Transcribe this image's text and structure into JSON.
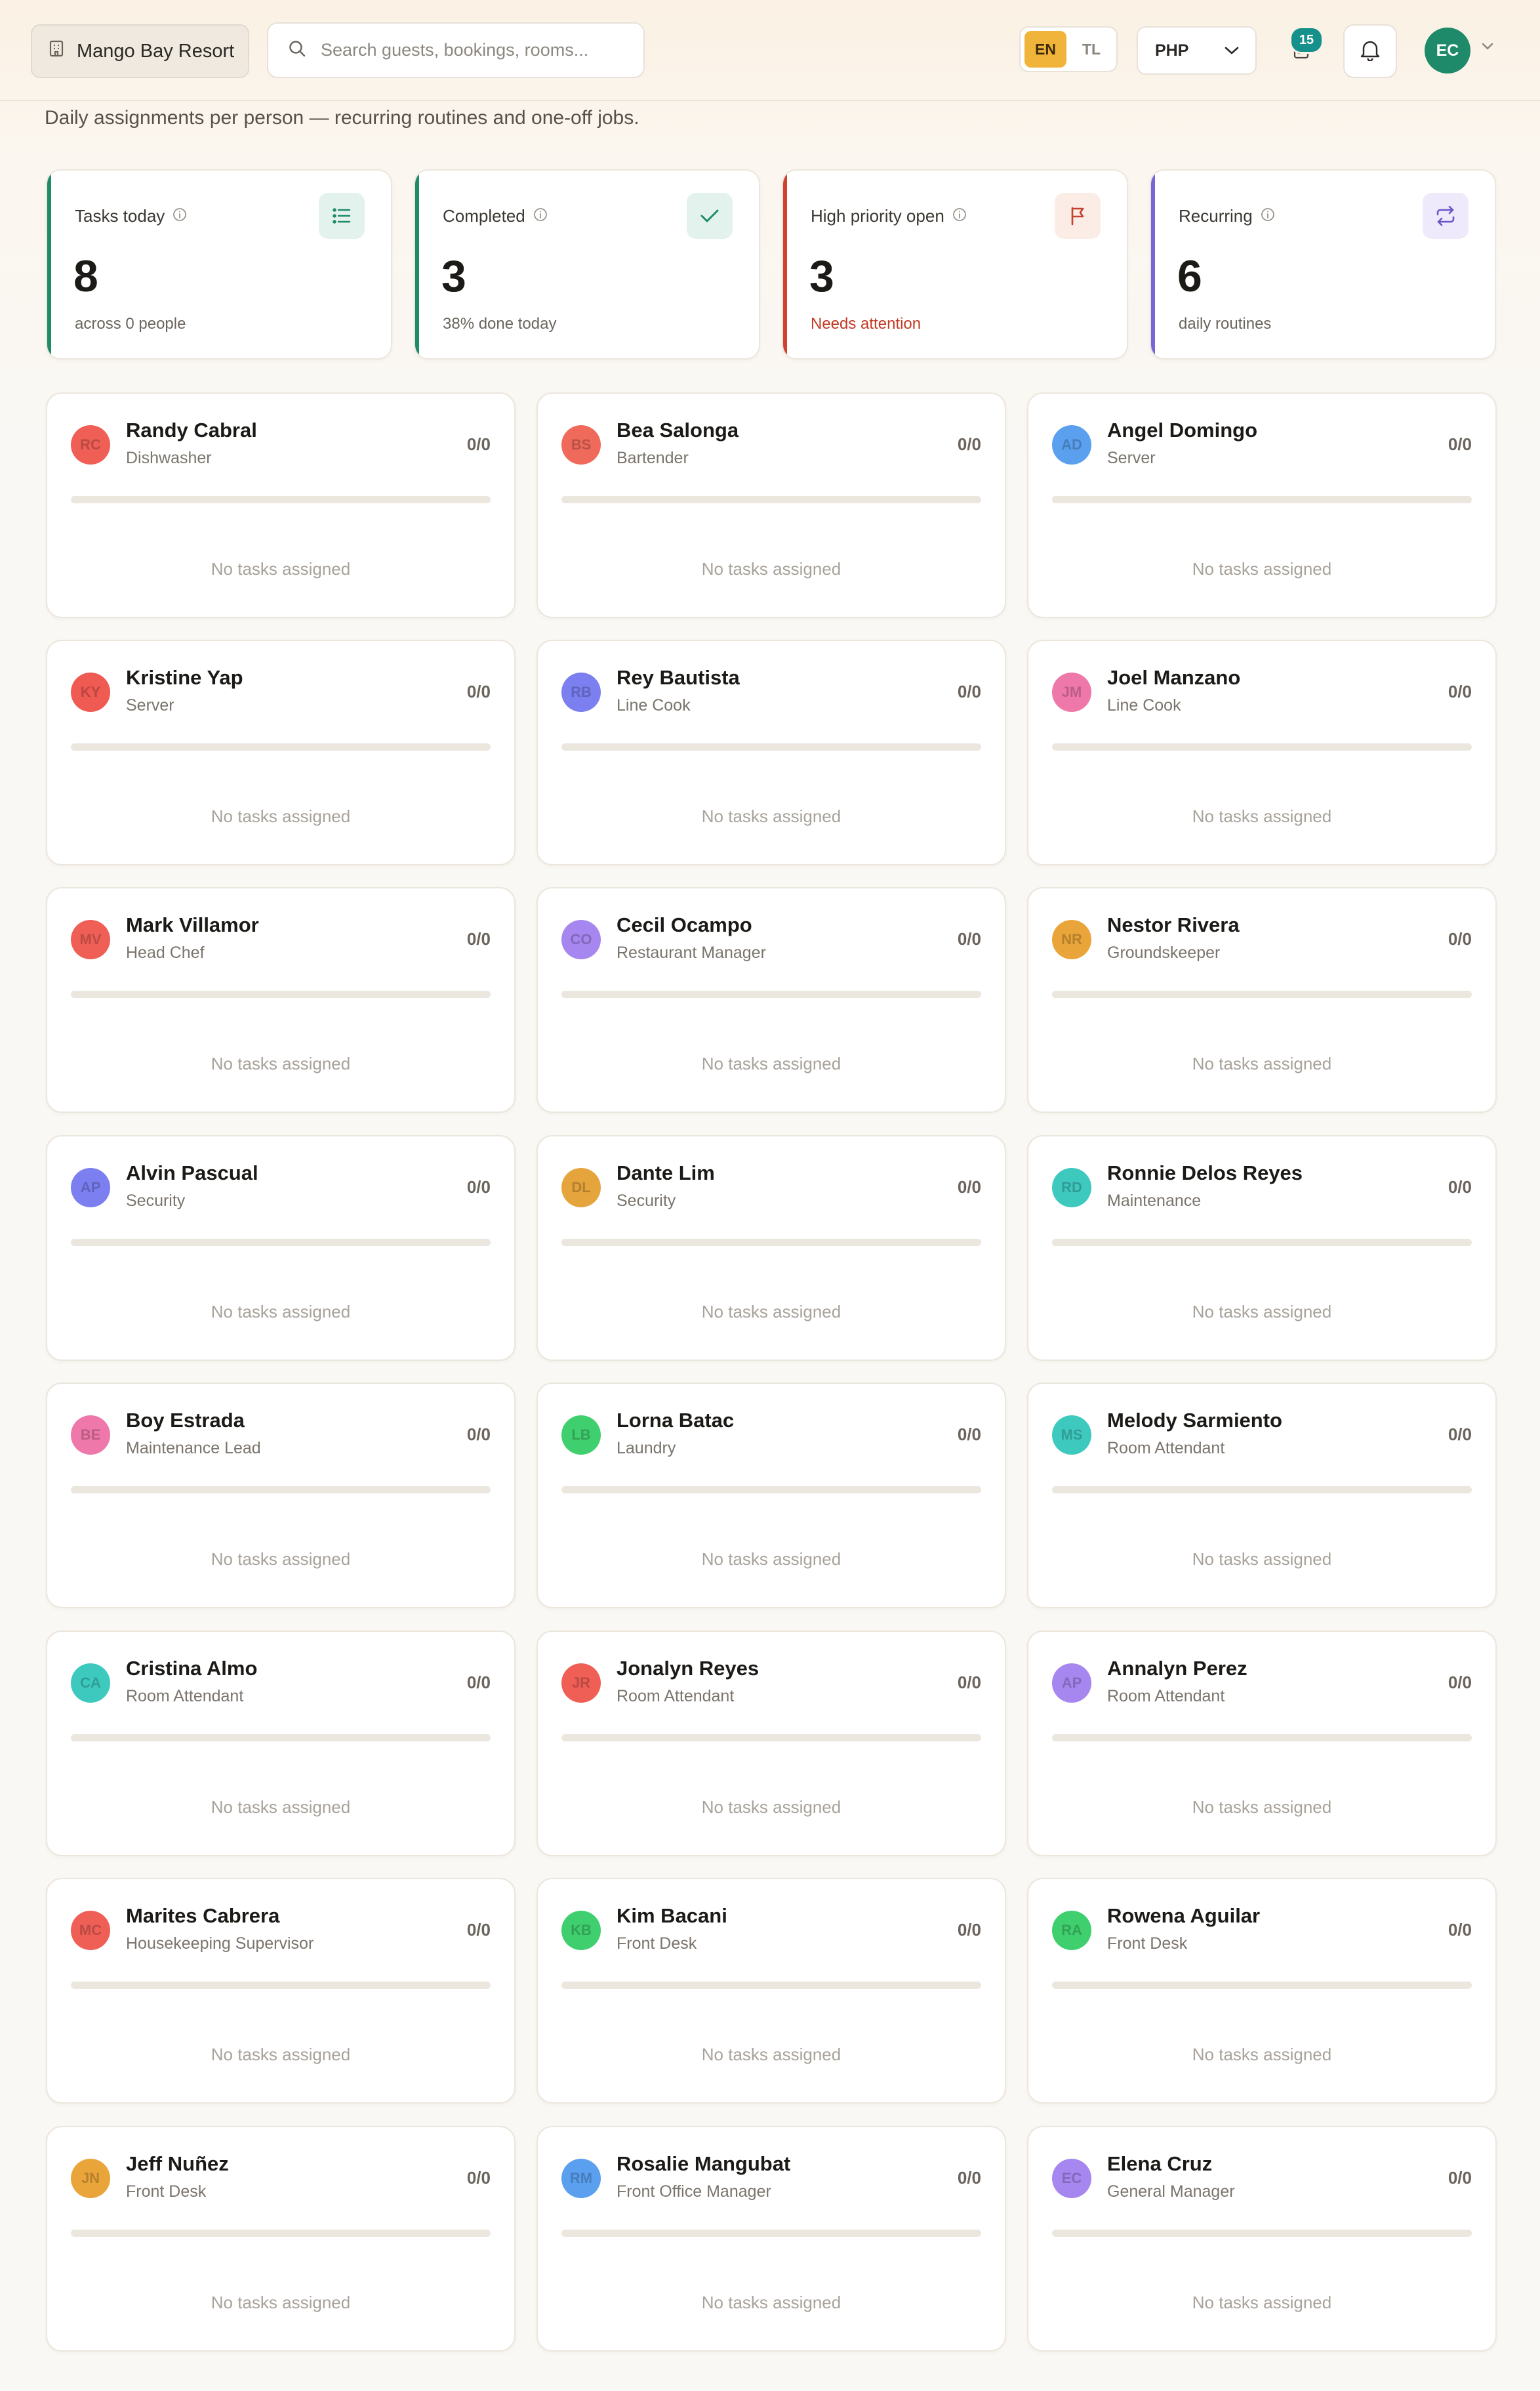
{
  "topbar": {
    "property_name": "Mango Bay Resort",
    "search_placeholder": "Search guests, bookings, rooms...",
    "languages": [
      "EN",
      "TL"
    ],
    "active_language": "EN",
    "currency": "PHP",
    "tasks_badge": "15",
    "user_initials": "EC"
  },
  "page": {
    "subtitle": "Daily assignments per person — recurring routines and one-off jobs."
  },
  "stats": [
    {
      "label": "Tasks today",
      "value": "8",
      "note": "across 0 people",
      "accent": "#1e8a6a",
      "icon": "list-icon",
      "icon_bg": "#e3f2ec",
      "icon_color": "#1e8a6a",
      "note_color": "#6b655e"
    },
    {
      "label": "Completed",
      "value": "3",
      "note": "38% done today",
      "accent": "#1e8a6a",
      "icon": "check-icon",
      "icon_bg": "#e3f2ec",
      "icon_color": "#1e8a6a",
      "note_color": "#6b655e"
    },
    {
      "label": "High priority open",
      "value": "3",
      "note": "Needs attention",
      "accent": "#d0412f",
      "icon": "flag-icon",
      "icon_bg": "#fbece6",
      "icon_color": "#c2412f",
      "note_color": "#c23a24"
    },
    {
      "label": "Recurring",
      "value": "6",
      "note": "daily routines",
      "accent": "#7b63d8",
      "icon": "repeat-icon",
      "icon_bg": "#efeafb",
      "icon_color": "#6d55c9",
      "note_color": "#6b655e"
    }
  ],
  "people": [
    {
      "name": "Randy Cabral",
      "role": "Dishwasher",
      "initials": "RC",
      "color": "#ef5f56",
      "count": "0/0",
      "progress": 0,
      "empty_text": "No tasks assigned"
    },
    {
      "name": "Bea Salonga",
      "role": "Bartender",
      "initials": "BS",
      "color": "#ef6a5b",
      "count": "0/0",
      "progress": 0,
      "empty_text": "No tasks assigned"
    },
    {
      "name": "Angel Domingo",
      "role": "Server",
      "initials": "AD",
      "color": "#5aa0ef",
      "count": "0/0",
      "progress": 0,
      "empty_text": "No tasks assigned"
    },
    {
      "name": "Kristine Yap",
      "role": "Server",
      "initials": "KY",
      "color": "#ef5a52",
      "count": "0/0",
      "progress": 0,
      "empty_text": "No tasks assigned"
    },
    {
      "name": "Rey Bautista",
      "role": "Line Cook",
      "initials": "RB",
      "color": "#7b7ff0",
      "count": "0/0",
      "progress": 0,
      "empty_text": "No tasks assigned"
    },
    {
      "name": "Joel Manzano",
      "role": "Line Cook",
      "initials": "JM",
      "color": "#ee78a9",
      "count": "0/0",
      "progress": 0,
      "empty_text": "No tasks assigned"
    },
    {
      "name": "Mark Villamor",
      "role": "Head Chef",
      "initials": "MV",
      "color": "#ef5f56",
      "count": "0/0",
      "progress": 0,
      "empty_text": "No tasks assigned"
    },
    {
      "name": "Cecil Ocampo",
      "role": "Restaurant Manager",
      "initials": "CO",
      "color": "#a686ef",
      "count": "0/0",
      "progress": 0,
      "empty_text": "No tasks assigned"
    },
    {
      "name": "Nestor Rivera",
      "role": "Groundskeeper",
      "initials": "NR",
      "color": "#eaa53a",
      "count": "0/0",
      "progress": 0,
      "empty_text": "No tasks assigned"
    },
    {
      "name": "Alvin Pascual",
      "role": "Security",
      "initials": "AP",
      "color": "#7b7ff0",
      "count": "0/0",
      "progress": 0,
      "empty_text": "No tasks assigned"
    },
    {
      "name": "Dante Lim",
      "role": "Security",
      "initials": "DL",
      "color": "#e6a43c",
      "count": "0/0",
      "progress": 0,
      "empty_text": "No tasks assigned"
    },
    {
      "name": "Ronnie Delos Reyes",
      "role": "Maintenance",
      "initials": "RD",
      "color": "#3ec9bf",
      "count": "0/0",
      "progress": 0,
      "empty_text": "No tasks assigned"
    },
    {
      "name": "Boy Estrada",
      "role": "Maintenance Lead",
      "initials": "BE",
      "color": "#ee78a9",
      "count": "0/0",
      "progress": 0,
      "empty_text": "No tasks assigned"
    },
    {
      "name": "Lorna Batac",
      "role": "Laundry",
      "initials": "LB",
      "color": "#3fcf6e",
      "count": "0/0",
      "progress": 0,
      "empty_text": "No tasks assigned"
    },
    {
      "name": "Melody Sarmiento",
      "role": "Room Attendant",
      "initials": "MS",
      "color": "#3ec9bf",
      "count": "0/0",
      "progress": 0,
      "empty_text": "No tasks assigned"
    },
    {
      "name": "Cristina Almo",
      "role": "Room Attendant",
      "initials": "CA",
      "color": "#3ec9bf",
      "count": "0/0",
      "progress": 0,
      "empty_text": "No tasks assigned"
    },
    {
      "name": "Jonalyn Reyes",
      "role": "Room Attendant",
      "initials": "JR",
      "color": "#ef5f56",
      "count": "0/0",
      "progress": 0,
      "empty_text": "No tasks assigned"
    },
    {
      "name": "Annalyn Perez",
      "role": "Room Attendant",
      "initials": "AP",
      "color": "#a686ef",
      "count": "0/0",
      "progress": 0,
      "empty_text": "No tasks assigned"
    },
    {
      "name": "Marites Cabrera",
      "role": "Housekeeping Supervisor",
      "initials": "MC",
      "color": "#ef5f56",
      "count": "0/0",
      "progress": 0,
      "empty_text": "No tasks assigned"
    },
    {
      "name": "Kim Bacani",
      "role": "Front Desk",
      "initials": "KB",
      "color": "#3fcf6e",
      "count": "0/0",
      "progress": 0,
      "empty_text": "No tasks assigned"
    },
    {
      "name": "Rowena Aguilar",
      "role": "Front Desk",
      "initials": "RA",
      "color": "#3fcf6e",
      "count": "0/0",
      "progress": 0,
      "empty_text": "No tasks assigned"
    },
    {
      "name": "Jeff Nuñez",
      "role": "Front Desk",
      "initials": "JN",
      "color": "#eaa53a",
      "count": "0/0",
      "progress": 0,
      "empty_text": "No tasks assigned"
    },
    {
      "name": "Rosalie Mangubat",
      "role": "Front Office Manager",
      "initials": "RM",
      "color": "#5aa0ef",
      "count": "0/0",
      "progress": 0,
      "empty_text": "No tasks assigned"
    },
    {
      "name": "Elena Cruz",
      "role": "General Manager",
      "initials": "EC",
      "color": "#a686ef",
      "count": "0/0",
      "progress": 0,
      "empty_text": "No tasks assigned"
    }
  ]
}
